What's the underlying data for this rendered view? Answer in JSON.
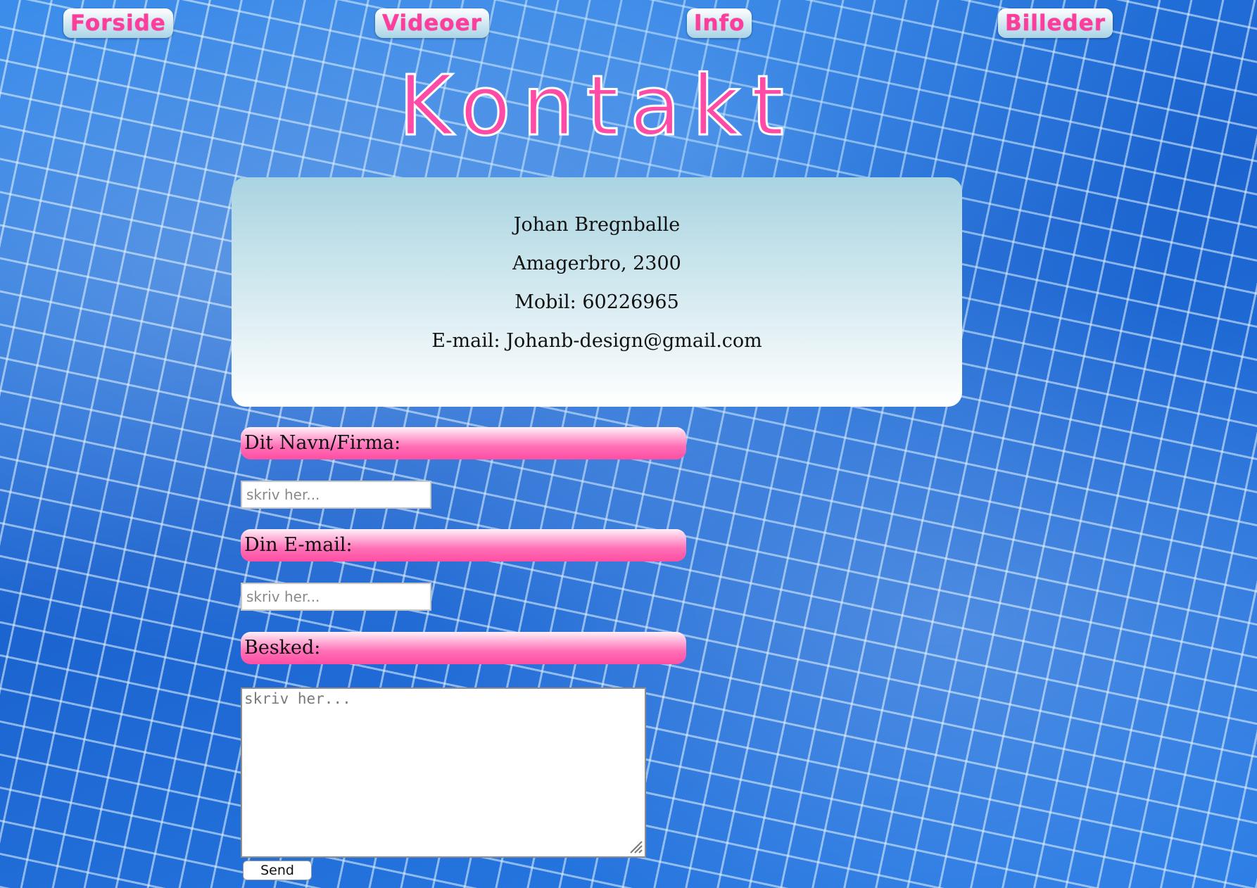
{
  "nav": {
    "items": [
      {
        "label": "Forside"
      },
      {
        "label": "Videoer"
      },
      {
        "label": "Info"
      },
      {
        "label": "Billeder"
      }
    ]
  },
  "page": {
    "title": "Kontakt"
  },
  "contact": {
    "name": "Johan Bregnballe",
    "address": "Amagerbro, 2300",
    "mobile": "Mobil: 60226965",
    "email": "E-mail: Johanb-design@gmail.com"
  },
  "form": {
    "name_label": "Dit Navn/Firma:",
    "name_placeholder": "skriv her...",
    "email_label": "Din E-mail:",
    "email_placeholder": "skriv her...",
    "message_label": "Besked:",
    "message_placeholder": "skriv her...",
    "send_label": "Send"
  },
  "colors": {
    "accent_pink": "#ff4aa6",
    "card_top": "#a9d4e1",
    "background_blue": "#1f6fd6"
  }
}
